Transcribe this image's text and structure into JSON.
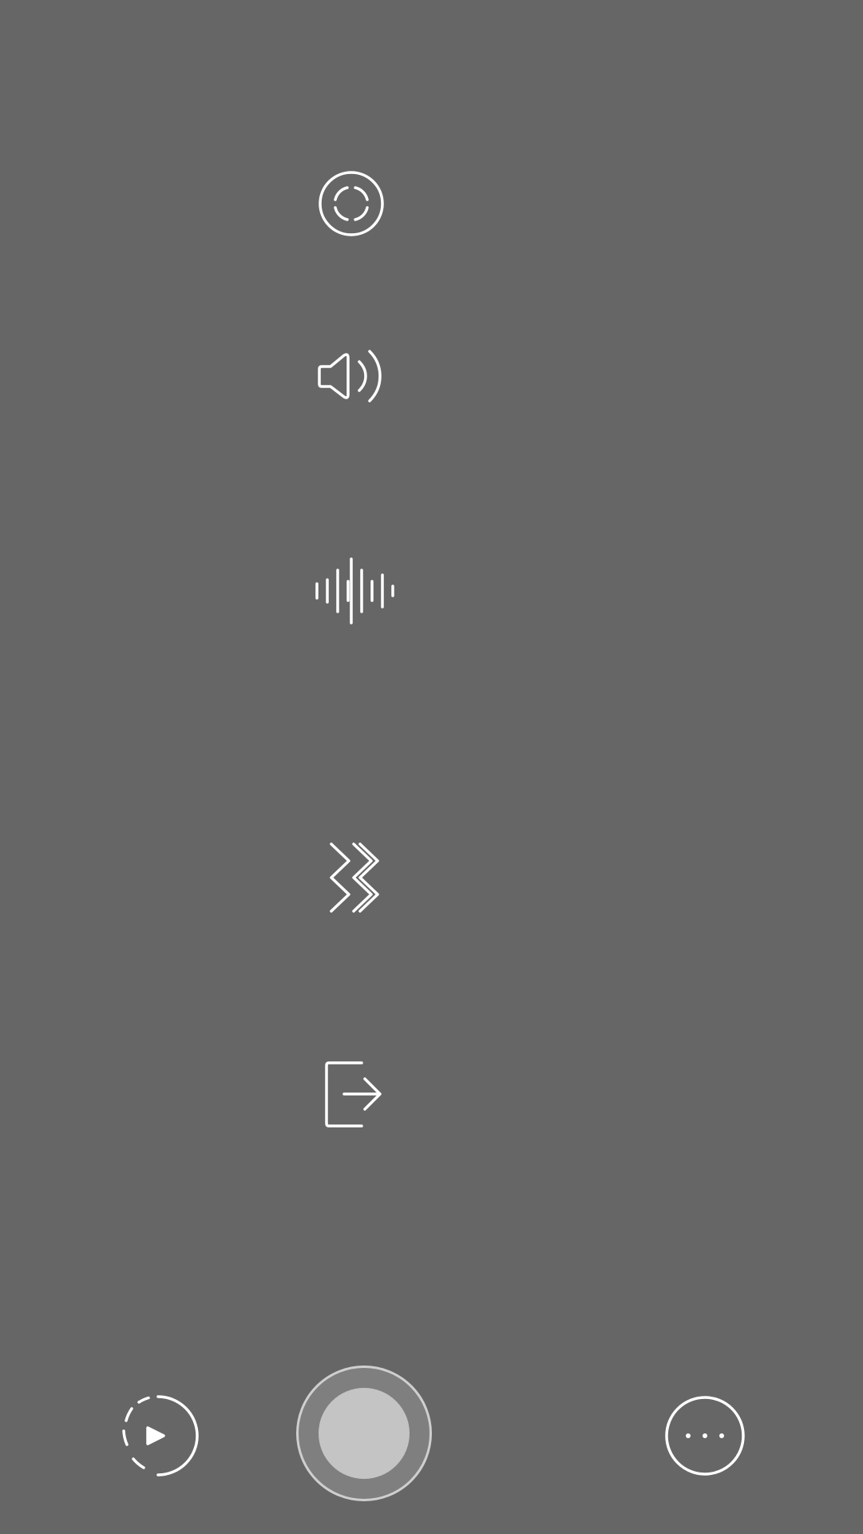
{
  "screen": {
    "background": "#666666",
    "icon_color": "#ffffff"
  },
  "menu": {
    "items": [
      {
        "icon": "focus-icon"
      },
      {
        "icon": "volume-icon"
      },
      {
        "icon": "audio-waveform-icon"
      },
      {
        "icon": "triple-chevron-right-icon"
      },
      {
        "icon": "exit-icon"
      }
    ]
  },
  "bottom_bar": {
    "left": {
      "icon": "play-timer-icon"
    },
    "center": {
      "icon": "capture-button"
    },
    "right": {
      "icon": "more-options-icon"
    }
  }
}
